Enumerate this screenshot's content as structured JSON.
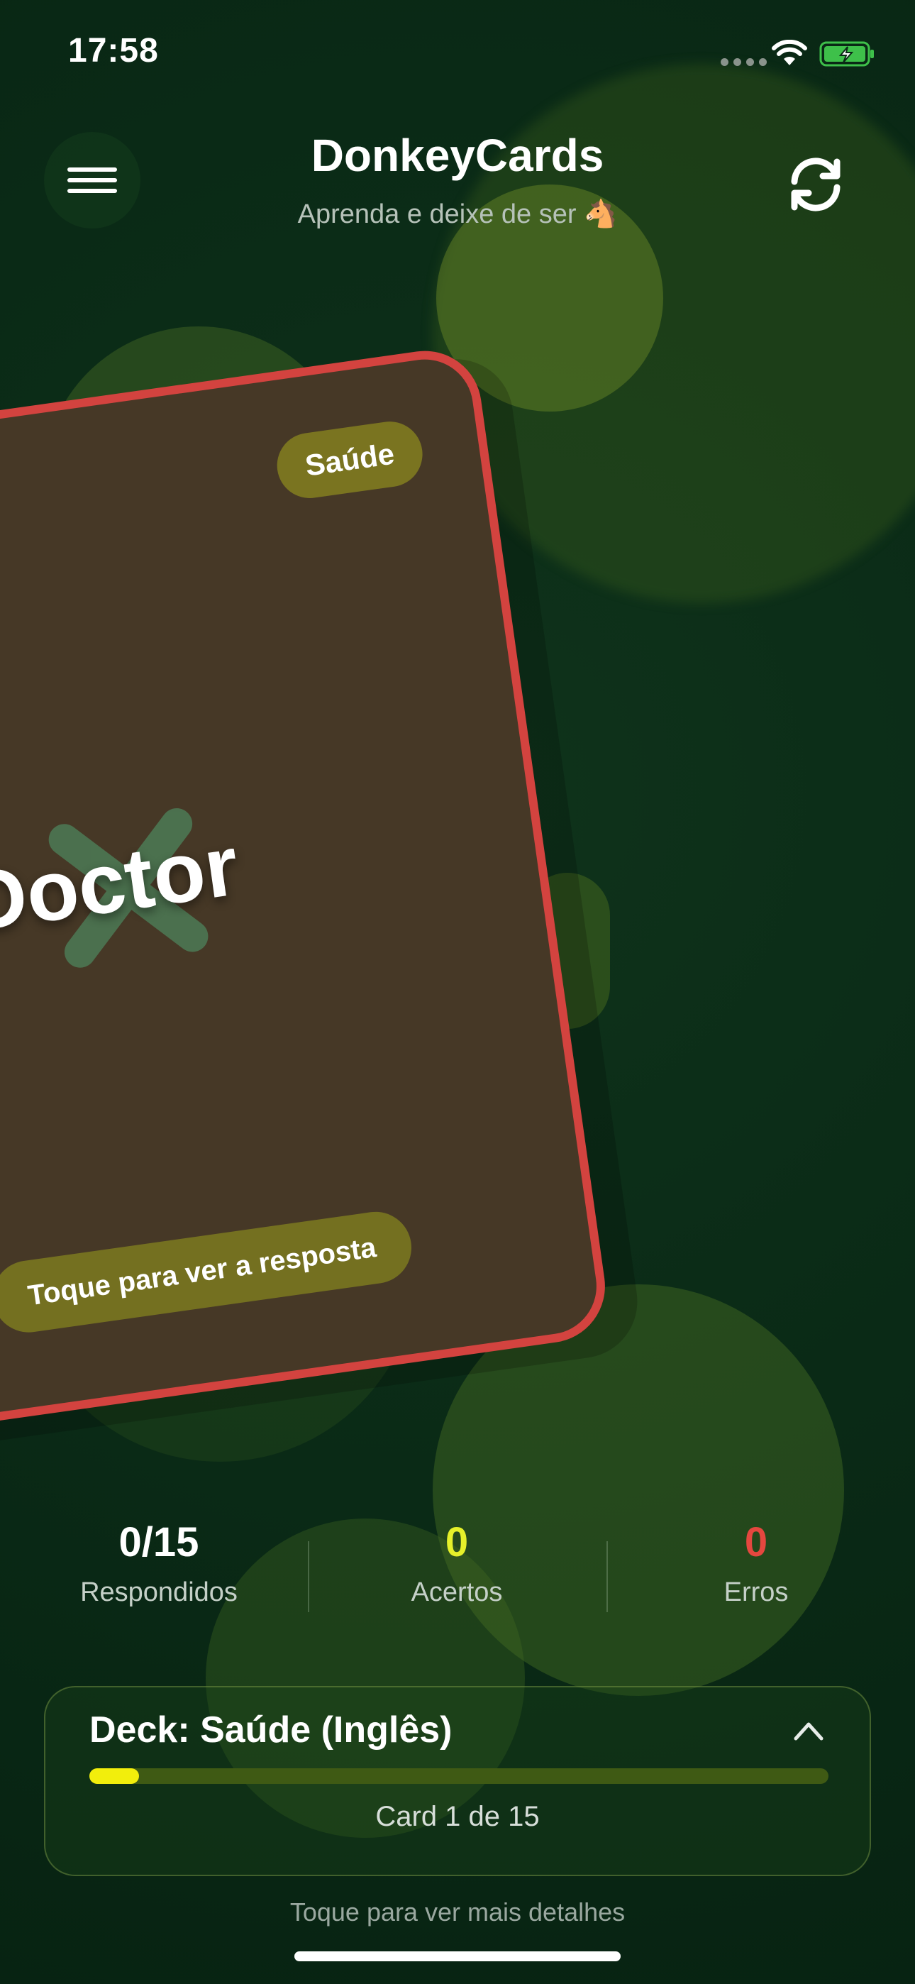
{
  "status_bar": {
    "time": "17:58",
    "icons": [
      "cellular-signal-icon",
      "wifi-icon",
      "battery-charging-icon"
    ],
    "battery_color": "#3ec04a"
  },
  "header": {
    "title": "DonkeyCards",
    "subtitle": "Aprenda e deixe de ser 🐴",
    "menu_icon": "hamburger-menu-icon",
    "refresh_icon": "refresh-icon"
  },
  "card": {
    "category": "Saúde",
    "word": "Doctor",
    "hint": "Toque para ver a resposta",
    "border_color": "#d3433f",
    "status_mark": "x-mark-icon"
  },
  "stats": [
    {
      "value": "0/15",
      "label": "Respondidos",
      "color": "#ffffff"
    },
    {
      "value": "0",
      "label": "Acertos",
      "color": "#e6f02a"
    },
    {
      "value": "0",
      "label": "Erros",
      "color": "#e5473f"
    }
  ],
  "deck": {
    "title": "Deck: Saúde (Inglês)",
    "counter": "Card 1 de 15",
    "progress": 0.067,
    "progress_color": "#f2ee0c"
  },
  "footer": {
    "hint": "Toque para ver mais detalhes"
  }
}
